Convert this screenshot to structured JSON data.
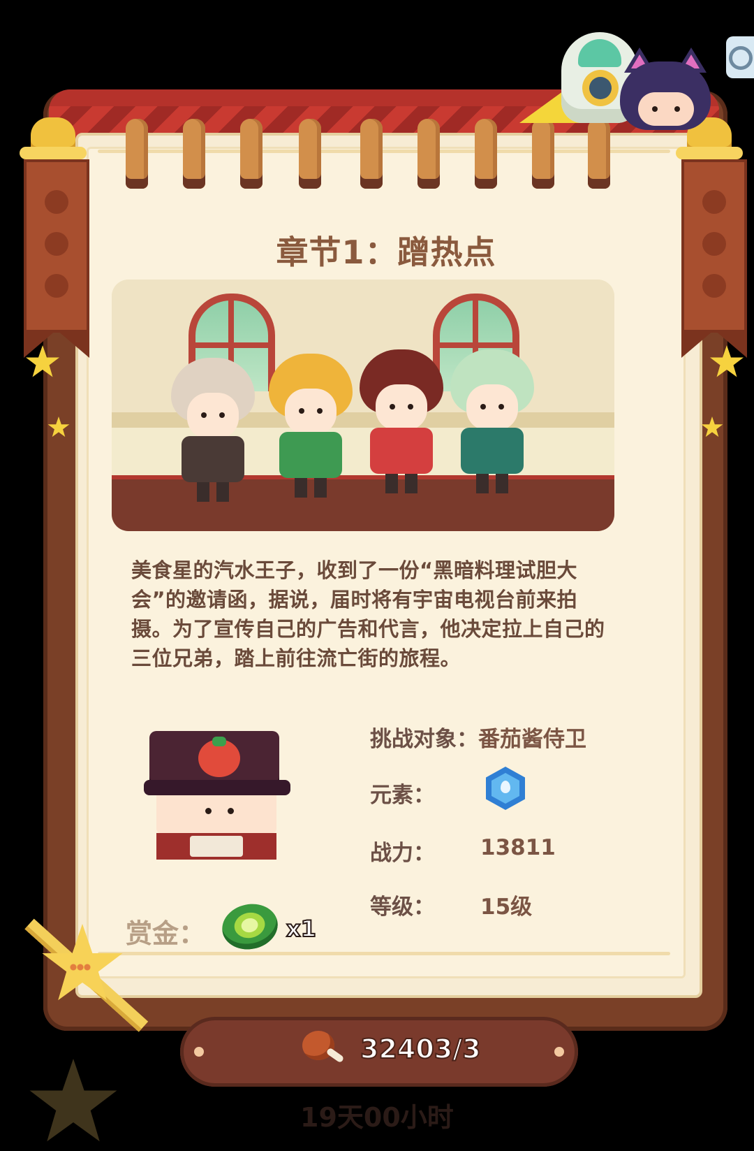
{
  "chapter": {
    "title": "章节1：蹭热点",
    "description": "美食星的汽水王子，收到了一份“黑暗料理试胆大会”的邀请函，据说，届时将有宇宙电视台前来拍摄。为了宣传自己的广告和代言，他决定拉上自己的三位兄弟，踏上前往流亡街的旅程。"
  },
  "challenge": {
    "target_label": "挑战对象：",
    "target_value": "番茄酱侍卫",
    "element_label": "元素：",
    "element_icon": "water-element-icon",
    "power_label": "战力：",
    "power_value": "13811",
    "level_label": "等级：",
    "level_value": "15级"
  },
  "reward": {
    "label": "赏金：",
    "icon": "cucumber-slice-icon",
    "count": "x1"
  },
  "stamina": {
    "icon": "meat-drumstick-icon",
    "value": "32403/3"
  },
  "timer": "19天00小时",
  "colors": {
    "frame": "#7a4027",
    "paper": "#fbf2dd",
    "valance": "#b5322b",
    "text": "#6a4a3a"
  }
}
